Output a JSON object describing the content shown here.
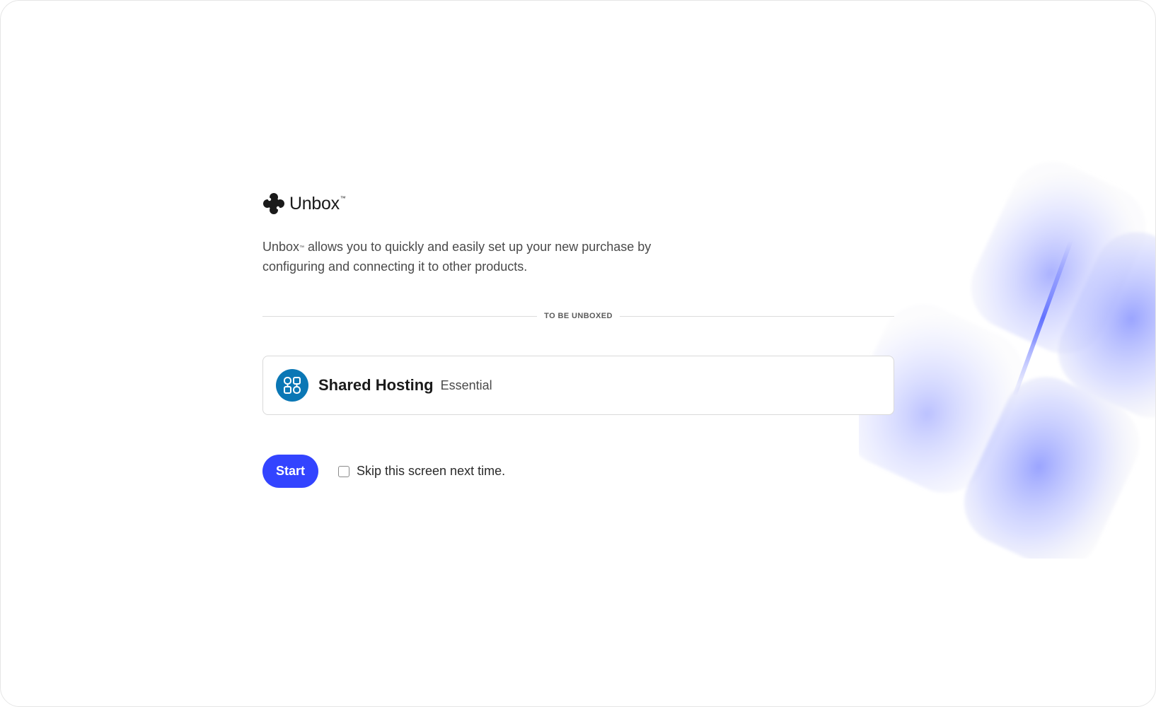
{
  "brand": {
    "name": "Unbox",
    "trademark": "™",
    "icon": "unbox-logo-icon"
  },
  "description": {
    "part1": "Unbox",
    "trademark": "™",
    "part2": " allows you to quickly and easily set up your new purchase by configuring and connecting it to other products."
  },
  "section": {
    "label": "TO BE UNBOXED"
  },
  "product": {
    "icon": "shared-hosting-icon",
    "name": "Shared Hosting",
    "tier": "Essential",
    "icon_color": "#0a77b5"
  },
  "actions": {
    "start_label": "Start",
    "skip_label": "Skip this screen next time.",
    "skip_checked": false
  },
  "colors": {
    "accent": "#3344ff",
    "decor": "#7f8cff"
  }
}
